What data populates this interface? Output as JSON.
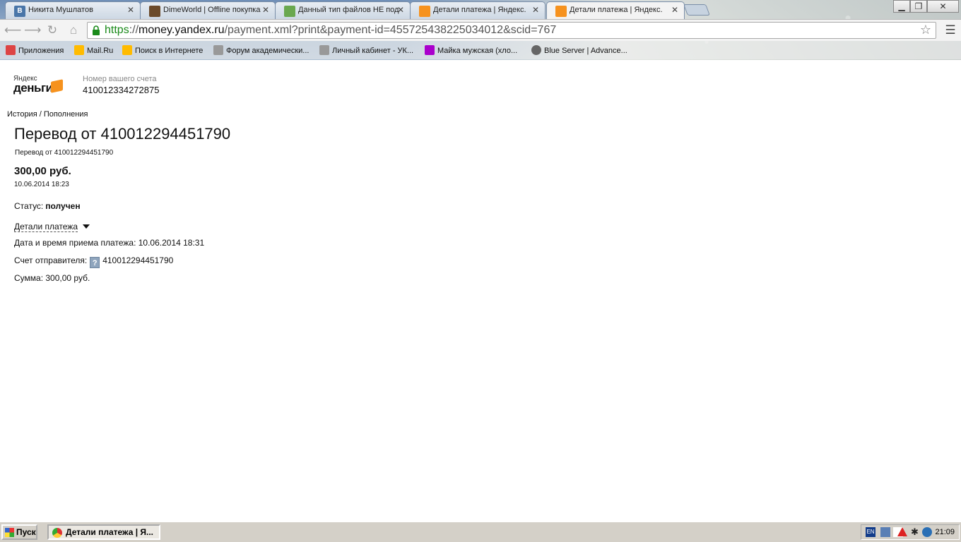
{
  "browser": {
    "tabs": [
      {
        "title": "Никита Мушлатов",
        "favicon": "vk-icon",
        "color": "#4a76a8",
        "glyph": "B"
      },
      {
        "title": "DimeWorld | Offline покупка",
        "favicon": "dimeworld-icon",
        "color": "#6b4a2a",
        "glyph": ""
      },
      {
        "title": "Данный тип файлов НЕ под",
        "favicon": "image-icon",
        "color": "#6aa84f",
        "glyph": ""
      },
      {
        "title": "Детали платежа | Яндекс.",
        "favicon": "yandex-money-icon",
        "color": "#f6921e",
        "glyph": ""
      },
      {
        "title": "Детали платежа | Яндекс.",
        "favicon": "yandex-money-icon",
        "color": "#f6921e",
        "glyph": ""
      }
    ],
    "url": {
      "scheme": "https",
      "sep": "://",
      "host": "money.yandex.ru",
      "path": "/payment.xml?print&payment-id=455725438225034012&scid=767"
    },
    "bookmarks": [
      {
        "label": "Приложения",
        "color": "#d44"
      },
      {
        "label": "Mail.Ru",
        "color": "#fb0"
      },
      {
        "label": "Поиск в Интернете",
        "color": "#fb0"
      },
      {
        "label": "Форум академически...",
        "color": "#999"
      },
      {
        "label": "Личный кабинет - УК...",
        "color": "#999"
      },
      {
        "label": "Майка мужская (хло...",
        "color": "#a0c"
      },
      {
        "label": "Blue Server | Advance...",
        "color": "#666"
      }
    ]
  },
  "page": {
    "logo": {
      "small": "Яндекс",
      "big": "деньги"
    },
    "account_label": "Номер вашего счета",
    "account_number": "410012334272875",
    "breadcrumb": "История / Пополнения",
    "title": "Перевод от 410012294451790",
    "subtitle": "Перевод от 410012294451790",
    "amount": "300,00 руб.",
    "date": "10.06.2014 18:23",
    "status_label": "Статус:",
    "status_value": "получен",
    "details_link": "Детали платежа",
    "received_line": "Дата и время приема платежа: 10.06.2014 18:31",
    "sender_label": "Счет отправителя:",
    "sender_help": "?",
    "sender_account": "410012294451790",
    "sum_line": "Сумма: 300,00 руб."
  },
  "taskbar": {
    "start": "Пуск",
    "task": "Детали платежа | Я...",
    "lang": "EN",
    "clock": "21:09"
  }
}
